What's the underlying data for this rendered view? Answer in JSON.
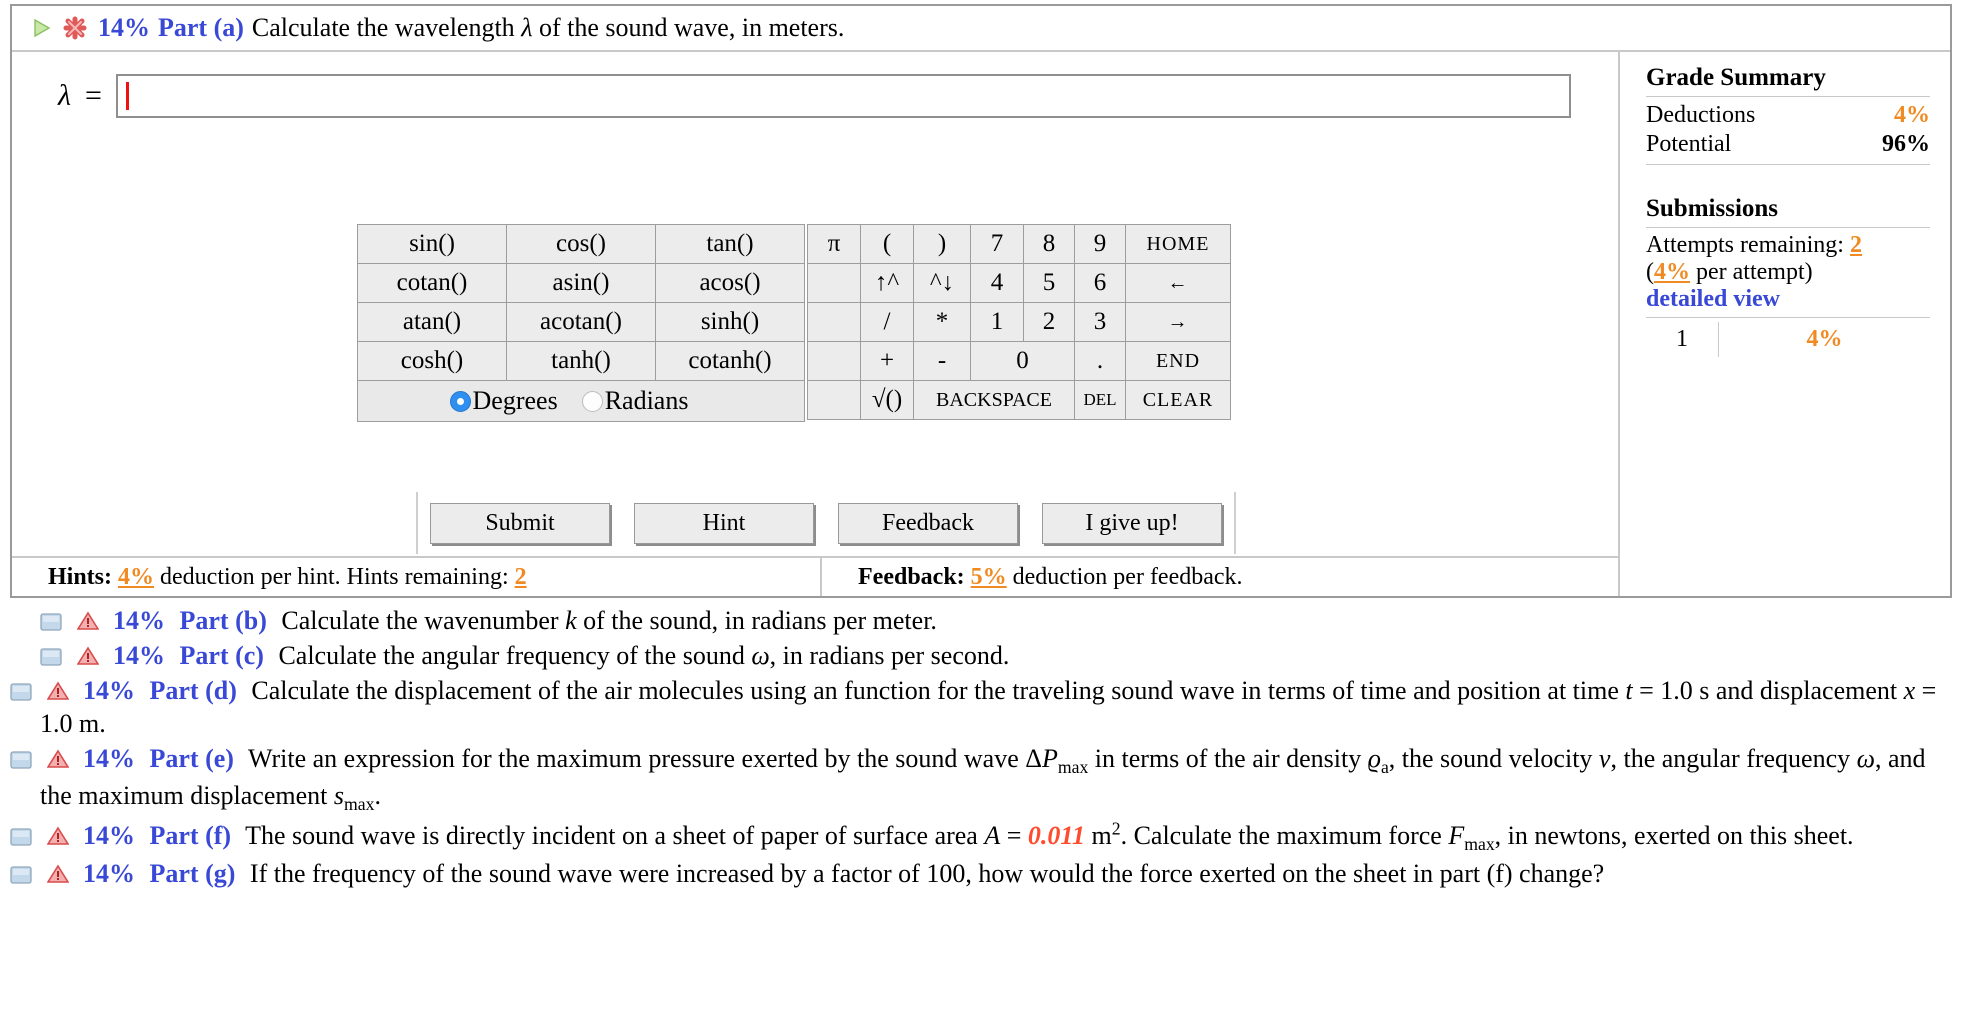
{
  "colors": {
    "accent_blue": "#3949d6",
    "orange": "#f08a23",
    "red_value": "#ff4b2e",
    "radio_blue": "#2f8ff0"
  },
  "active_part": {
    "status_icons": [
      "play-triangle-icon",
      "incorrect-x-icon"
    ],
    "percent": "14%",
    "part_label": "Part (a)",
    "prompt_prefix": "Calculate the wavelength ",
    "prompt_symbol": "λ",
    "prompt_suffix": " of the sound wave, in meters."
  },
  "answer": {
    "label": "λ",
    "equals": "=",
    "value": "",
    "placeholder": ""
  },
  "calculator": {
    "function_rows": [
      [
        "sin()",
        "cos()",
        "tan()"
      ],
      [
        "cotan()",
        "asin()",
        "acos()"
      ],
      [
        "atan()",
        "acotan()",
        "sinh()"
      ],
      [
        "cosh()",
        "tanh()",
        "cotanh()"
      ]
    ],
    "angle_mode": {
      "selected": "Degrees",
      "options": [
        "Degrees",
        "Radians"
      ]
    },
    "keypad_rows": [
      [
        {
          "label": "π",
          "state": "enabled"
        },
        {
          "label": "(",
          "state": "enabled"
        },
        {
          "label": ")",
          "state": "disabled"
        },
        {
          "label": "7",
          "state": "enabled"
        },
        {
          "label": "8",
          "state": "enabled"
        },
        {
          "label": "9",
          "state": "enabled"
        },
        {
          "label": "HOME",
          "state": "disabled"
        }
      ],
      [
        {
          "label": "",
          "state": "blank"
        },
        {
          "label": "↑^",
          "state": "disabled"
        },
        {
          "label": "^↓",
          "state": "disabled"
        },
        {
          "label": "4",
          "state": "enabled"
        },
        {
          "label": "5",
          "state": "enabled"
        },
        {
          "label": "6",
          "state": "enabled"
        },
        {
          "label": "←",
          "state": "disabled"
        }
      ],
      [
        {
          "label": "",
          "state": "blank"
        },
        {
          "label": "/",
          "state": "disabled"
        },
        {
          "label": "*",
          "state": "enabled"
        },
        {
          "label": "1",
          "state": "enabled"
        },
        {
          "label": "2",
          "state": "enabled"
        },
        {
          "label": "3",
          "state": "enabled"
        },
        {
          "label": "→",
          "state": "disabled"
        }
      ],
      [
        {
          "label": "",
          "state": "blank"
        },
        {
          "label": "+",
          "state": "enabled"
        },
        {
          "label": "-",
          "state": "enabled"
        },
        {
          "label": "0",
          "state": "enabled"
        },
        {
          "label": ".",
          "state": "enabled"
        },
        {
          "label": "END",
          "state": "disabled"
        }
      ],
      [
        {
          "label": "",
          "state": "blank"
        },
        {
          "label": "√()",
          "state": "enabled"
        },
        {
          "label": "BACKSPACE",
          "state": "disabled"
        },
        {
          "label": "DEL",
          "state": "disabled"
        },
        {
          "label": "CLEAR",
          "state": "disabled"
        }
      ]
    ]
  },
  "actions": {
    "submit": "Submit",
    "hint": "Hint",
    "feedback": "Feedback",
    "give_up": "I give up!"
  },
  "footer": {
    "hints_label": "Hints:",
    "hints_deduction": "4%",
    "hints_text_mid": " deduction per hint. Hints remaining: ",
    "hints_remaining": "2",
    "feedback_label": "Feedback:",
    "feedback_deduction": "5%",
    "feedback_text": " deduction per feedback."
  },
  "grade_summary": {
    "title": "Grade Summary",
    "rows": [
      {
        "label": "Deductions",
        "value": "4%",
        "highlight": true
      },
      {
        "label": "Potential",
        "value": "96%",
        "highlight": false
      }
    ],
    "submissions_title": "Submissions",
    "attempts_label": "Attempts remaining:",
    "attempts_value": "2",
    "per_attempt_open": "(",
    "per_attempt_pct": "4%",
    "per_attempt_close": " per attempt)",
    "detailed_view": "detailed view",
    "attempt_table": [
      {
        "n": "1",
        "pct": "4%"
      }
    ]
  },
  "other_parts": [
    {
      "percent": "14%",
      "label": "Part (b)",
      "text_html": "Calculate the wavenumber <i>k</i> of the sound, in radians per meter.",
      "text": "Calculate the wavenumber k of the sound, in radians per meter."
    },
    {
      "percent": "14%",
      "label": "Part (c)",
      "text_html": "Calculate the angular frequency of the sound <i>ω</i>, in radians per second.",
      "text": "Calculate the angular frequency of the sound ω, in radians per second."
    },
    {
      "percent": "14%",
      "label": "Part (d)",
      "text_html": "Calculate the displacement of the air molecules using an function for the traveling sound wave in terms of time and position at time <i>t</i> = 1.0 s and displacement <i>x</i> = 1.0 m.",
      "text": "Calculate the displacement of the air molecules using an function for the traveling sound wave in terms of time and position at time t = 1.0 s and displacement x = 1.0 m."
    },
    {
      "percent": "14%",
      "label": "Part (e)",
      "text_html": "Write an expression for the maximum pressure exerted by the sound wave Δ<i>P</i><sub>max</sub> in terms of the air density <i>ϱ</i><sub>a</sub>, the sound velocity <i>v</i>, the angular frequency <i>ω</i>, and the maximum displacement <i>s</i><sub>max</sub>.",
      "text": "Write an expression for the maximum pressure exerted by the sound wave ΔPmax in terms of the air density ϱa, the sound velocity v, the angular frequency ω, and the maximum displacement smax."
    },
    {
      "percent": "14%",
      "label": "Part (f)",
      "text_html": "The sound wave is directly incident on a sheet of paper of surface area <i>A</i> = <span class=\"redval\">0.011</span> m<sup>2</sup>. Calculate the maximum force <i>F</i><sub>max</sub>, in newtons, exerted on this sheet.",
      "text": "The sound wave is directly incident on a sheet of paper of surface area A = 0.011 m2. Calculate the maximum force Fmax, in newtons, exerted on this sheet.",
      "value": "0.011"
    },
    {
      "percent": "14%",
      "label": "Part (g)",
      "text_html": "If the frequency of the sound wave were increased by a factor of 100, how would the force exerted on the sheet in part (f) change?",
      "text": "If the frequency of the sound wave were increased by a factor of 100, how would the force exerted on the sheet in part (f) change?"
    }
  ]
}
